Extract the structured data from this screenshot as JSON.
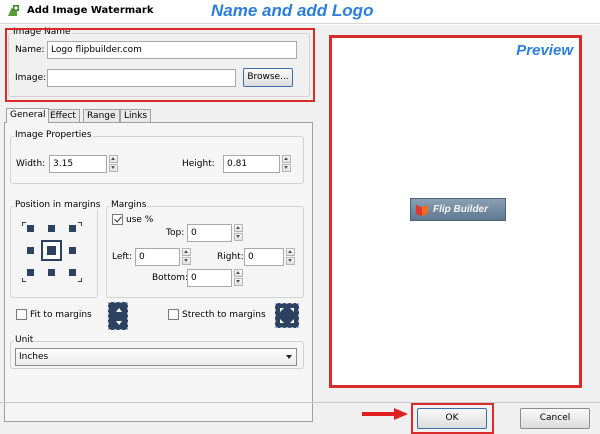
{
  "window": {
    "title": "Add Image Watermark"
  },
  "annotations": {
    "header": "Name and add Logo",
    "preview": "Preview"
  },
  "image_name": {
    "group_label": "Image Name",
    "name_label": "Name:",
    "name_value": "Logo flipbuilder.com",
    "image_label": "Image:",
    "image_value": "",
    "browse_label": "Browse..."
  },
  "tabs": [
    "General",
    "Effect",
    "Range",
    "Links"
  ],
  "image_properties": {
    "group_label": "Image Properties",
    "width_label": "Width:",
    "width_value": "3.15",
    "height_label": "Height:",
    "height_value": "0.81"
  },
  "position": {
    "group_label": "Position in margins"
  },
  "margins": {
    "group_label": "Margins",
    "use_pct_label": "use %",
    "use_pct_checked": true,
    "top_label": "Top:",
    "top_value": "0",
    "left_label": "Left:",
    "left_value": "0",
    "right_label": "Right:",
    "right_value": "0",
    "bottom_label": "Bottom:",
    "bottom_value": "0"
  },
  "fit": {
    "label": "Fit to margins",
    "checked": false
  },
  "stretch": {
    "label": "Strecth to margins",
    "checked": false
  },
  "unit": {
    "group_label": "Unit",
    "selected": "Inches"
  },
  "preview_logo_text": "Flip Builder",
  "footer": {
    "ok_label": "OK",
    "cancel_label": "Cancel"
  },
  "colors": {
    "highlight": "#d92b2b",
    "annotation": "#2b7fd9",
    "icon_fill": "#2d4160"
  }
}
